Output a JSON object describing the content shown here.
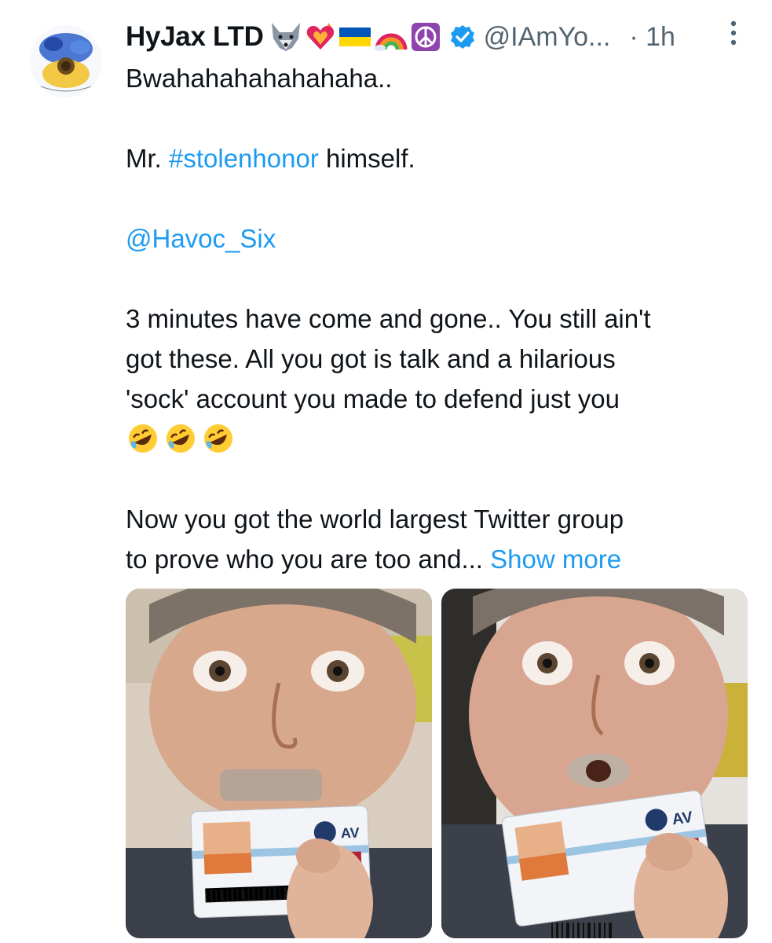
{
  "tweet": {
    "display_name": "HyJax LTD",
    "name_emojis": [
      "wolf-face",
      "heart-on-fire",
      "ukraine-flag",
      "rainbow",
      "peace-symbol"
    ],
    "verified": true,
    "handle": "@IAmYo...",
    "time": "· 1h",
    "lines": {
      "l1": "Bwahahahahahahaha..",
      "l2_prefix": "Mr. ",
      "l2_hashtag": "#stolenhonor",
      "l2_suffix": " himself.",
      "mention": "@Havoc_Six",
      "p3_line1": "3 minutes have come and gone.. You still ain't",
      "p3_line2": "got these. All you got is talk and a hilarious",
      "p3_line3": "'sock' account you made to defend just you",
      "p3_emoji": [
        "rolling-on-floor-laughing",
        "rolling-on-floor-laughing",
        "rolling-on-floor-laughing"
      ],
      "p4_line1": "Now you got the world largest Twitter group",
      "p4_line2": "to prove who you are too and...",
      "show_more": "Show more"
    },
    "media": [
      {
        "id_card_text": "AV"
      },
      {
        "id_card_text": "AV"
      }
    ],
    "colors": {
      "link": "#1d9bf0",
      "secondary": "#536471",
      "verified": "#1d9bf0"
    }
  }
}
